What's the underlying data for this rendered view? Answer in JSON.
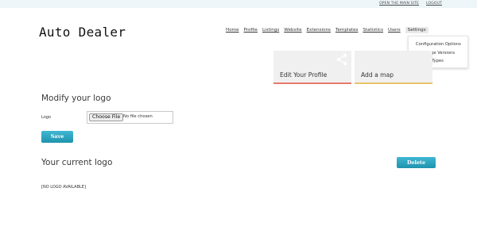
{
  "top_links": [
    "OPEN THE MAIN SITE",
    "LOGOUT"
  ],
  "logo": "Auto Dealer",
  "nav": {
    "items": [
      "Home",
      "Profile",
      "Listings",
      "Website",
      "Extensions",
      "Templates",
      "Statistics",
      "Users",
      "Settings"
    ]
  },
  "settings_menu": [
    "Configuration Options",
    "Language Versions",
    "Vehicle Types"
  ],
  "tiles": {
    "profile": "Edit Your Profile",
    "map": "Add a map"
  },
  "modify": {
    "title": "Modify your logo",
    "logo_label": "Logo",
    "choose_file": "Choose File",
    "no_file": "No file chosen",
    "save": "Save"
  },
  "current": {
    "title": "Your current logo",
    "delete": "Delete",
    "no_logo": "[NO LOGO AVAILABLE]"
  },
  "colors": {
    "accent": "#2aa6c1",
    "tile_profile_border": "#e87a6b",
    "tile_map_border": "#e9c46a"
  }
}
